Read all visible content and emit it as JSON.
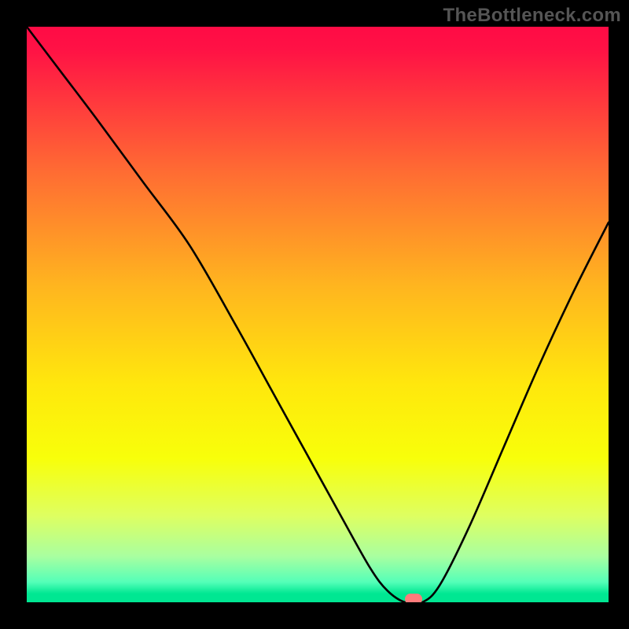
{
  "watermark": "TheBottleneck.com",
  "chart_data": {
    "type": "line",
    "title": "",
    "xlabel": "",
    "ylabel": "",
    "xlim": [
      0,
      100
    ],
    "ylim": [
      0,
      100
    ],
    "grid": false,
    "background": {
      "type": "vertical-gradient",
      "stops": [
        {
          "pos": 0.0,
          "color": "#ff0b45"
        },
        {
          "pos": 0.04,
          "color": "#ff1245"
        },
        {
          "pos": 0.25,
          "color": "#ff6b33"
        },
        {
          "pos": 0.45,
          "color": "#ffb51f"
        },
        {
          "pos": 0.62,
          "color": "#ffe70d"
        },
        {
          "pos": 0.75,
          "color": "#f8ff0a"
        },
        {
          "pos": 0.85,
          "color": "#deff61"
        },
        {
          "pos": 0.92,
          "color": "#a9ffa0"
        },
        {
          "pos": 0.965,
          "color": "#54ffb8"
        },
        {
          "pos": 0.985,
          "color": "#00e792"
        },
        {
          "pos": 1.0,
          "color": "#00e792"
        }
      ]
    },
    "series": [
      {
        "name": "bottleneck-curve",
        "color": "#000000",
        "x": [
          0,
          6,
          12,
          20,
          28,
          36,
          42,
          48,
          54,
          59,
          62,
          65,
          68,
          71,
          76,
          82,
          88,
          94,
          100
        ],
        "values": [
          100,
          92,
          84,
          73,
          62,
          48,
          37,
          26,
          15,
          6,
          2,
          0,
          0,
          3,
          13,
          27,
          41,
          54,
          66
        ]
      }
    ],
    "marker": {
      "x": 66.5,
      "y": 0,
      "color": "#ff7b7b"
    }
  }
}
